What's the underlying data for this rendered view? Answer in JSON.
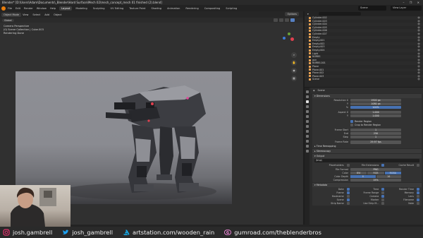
{
  "window": {
    "title": "Blender* [D:\\Users\\Adam\\Documents\\_Blender\\Hard Surface\\Mech 02\\mech_concept_mech 01 finished (2).blend]",
    "controls": "– ❐ ✕"
  },
  "menu": {
    "items": [
      "File",
      "Edit",
      "Render",
      "Window",
      "Help"
    ],
    "workspaces": [
      "Layout",
      "Modeling",
      "Sculpting",
      "UV Editing",
      "Texture Paint",
      "Shading",
      "Animation",
      "Rendering",
      "Compositing",
      "Scripting"
    ],
    "active_workspace": "Layout",
    "scene": "Scene",
    "view_layer": "View Layer"
  },
  "viewport": {
    "mode": "Object Mode",
    "menus": [
      "View",
      "Select",
      "Add",
      "Object"
    ],
    "orientation": "Global",
    "options": "Options",
    "info_lines": [
      "Camera Perspective",
      "(0) Scene Collection | Cube.003",
      "Rendering Done"
    ]
  },
  "gizmo_colors": {
    "x": "#e0404f",
    "y": "#6ba336",
    "z": "#3e7bd8"
  },
  "outliner": {
    "rows": [
      {
        "name": "Cylinder.002"
      },
      {
        "name": "Cylinder.003"
      },
      {
        "name": "Cylinder.004"
      },
      {
        "name": "Cylinder.005"
      },
      {
        "name": "Cylinder.006"
      },
      {
        "name": "Cylinder.007"
      },
      {
        "name": "Empty"
      },
      {
        "name": "Empty.001"
      },
      {
        "name": "Empty.002"
      },
      {
        "name": "Empty.003"
      },
      {
        "name": "Empty.004"
      },
      {
        "name": "Light"
      },
      {
        "name": "NURBS"
      },
      {
        "name": "gun"
      },
      {
        "name": "NURBS.001"
      },
      {
        "name": "Plane"
      },
      {
        "name": "Plane.001"
      },
      {
        "name": "Plane.002"
      },
      {
        "name": "Plane.003"
      },
      {
        "name": "Scene"
      }
    ]
  },
  "properties": {
    "crumb": "Scene",
    "dimensions": {
      "header": "Dimensions",
      "resolution_x_label": "Resolution X",
      "resolution_x": "1920 px",
      "resolution_y_label": "Y",
      "resolution_y": "1080 px",
      "percent_label": "%",
      "percent": "100%",
      "aspect_x_label": "Aspect X",
      "aspect_x": "1.000",
      "aspect_y_label": "Y",
      "aspect_y": "1.000",
      "render_region": "Render Region",
      "crop_region": "Crop to Render Region",
      "frame_start_label": "Frame Start",
      "frame_start": "1",
      "frame_end_label": "End",
      "frame_end": "250",
      "frame_step_label": "Step",
      "frame_step": "1",
      "frame_rate_label": "Frame Rate",
      "frame_rate": "29.97 fps",
      "time_remapping": "Time Remapping"
    },
    "stereoscopy": {
      "header": "Stereoscopy"
    },
    "output": {
      "header": "Output",
      "path": "/tmp\\",
      "placeholders": "Placeholders",
      "file_extensions": "File Extensions",
      "cache_result": "Cache Result",
      "file_format_label": "File Format",
      "file_format": "PNG",
      "color_label": "Color",
      "color_options": [
        "BW",
        "RGB",
        "RGBA"
      ],
      "color_selected": "RGBA",
      "color_depth_label": "Color Depth",
      "color_depth_options": [
        "8",
        "16"
      ],
      "color_depth_selected": "8",
      "compression_label": "Compression",
      "compression": "15%"
    },
    "metadata": {
      "header": "Metadata",
      "fields": [
        {
          "label": "Date",
          "on": true
        },
        {
          "label": "Time",
          "on": true
        },
        {
          "label": "Render Time",
          "on": true
        },
        {
          "label": "Frame",
          "on": true
        },
        {
          "label": "Frame Range",
          "on": false
        },
        {
          "label": "Memory",
          "on": true
        },
        {
          "label": "Hostname",
          "on": false
        },
        {
          "label": "Camera",
          "on": true
        },
        {
          "label": "Lens",
          "on": false
        },
        {
          "label": "Scene",
          "on": true
        },
        {
          "label": "Marker",
          "on": false
        },
        {
          "label": "Filename",
          "on": true
        },
        {
          "label": "Strip Name",
          "on": false
        },
        {
          "label": "Use Strip M...",
          "on": false
        },
        {
          "label": "Note",
          "on": false
        }
      ]
    }
  },
  "social": [
    {
      "icon": "instagram-icon",
      "text": "josh.gambrell",
      "color": "#e1306c"
    },
    {
      "icon": "twitter-icon",
      "text": "josh_gambrell",
      "color": "#1da1f2"
    },
    {
      "icon": "artstation-icon",
      "text": "artstation.com/wooden_rain",
      "color": "#13aff0"
    },
    {
      "icon": "gumroad-icon",
      "text": "gumroad.com/theblenderbros",
      "color": "#ff90e8"
    }
  ]
}
